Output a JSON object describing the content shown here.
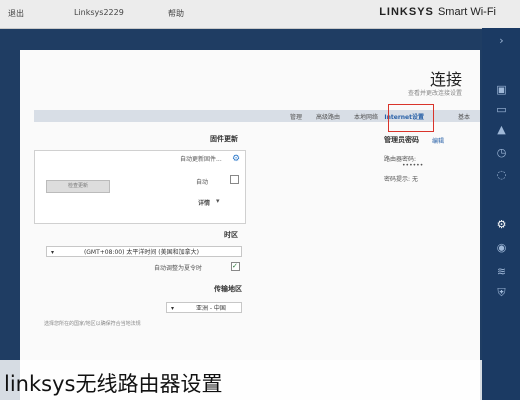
{
  "topbar": {
    "item1": "退出",
    "item2": "Linksys2229",
    "item3": "帮助",
    "brand": "LINKSYS",
    "brand_suffix": "Smart Wi-Fi"
  },
  "card": {
    "title": "连接",
    "subtitle": "查看并更改连接设置"
  },
  "tabs": [
    "基本",
    "Internet设置",
    "本地网络",
    "高级路由",
    "管理"
  ],
  "admin": {
    "heading": "管理员密码",
    "edit_link": "编辑",
    "pwd_label": "路由器密码:",
    "pwd_value": "••••••",
    "hint_label": "密码提示:",
    "hint_value": "无"
  },
  "firmware": {
    "heading": "固件更新",
    "status": "自动更新固件...",
    "check_button": "检查更新",
    "manual_label": "自动",
    "details": "详情"
  },
  "timezone": {
    "heading": "时区",
    "value": "(GMT+08:00) 太平洋时间 (美国和加拿大)",
    "dst_label": "自动调整为夏令时"
  },
  "region": {
    "heading": "传输地区",
    "value": "亚洲 - 中国",
    "note": "选择您所在的国家/地区以确保符合当地法规"
  },
  "icons": {
    "collapse": "chevron-right-icon",
    "side1": "device-icon",
    "side2": "router-icon",
    "side3": "wrench-icon",
    "side4": "clock-icon",
    "side5": "gear-icon",
    "side6": "camera-icon",
    "side7": "wifi-icon",
    "side8": "shield-icon"
  },
  "caption": "linksys无线路由器设置"
}
